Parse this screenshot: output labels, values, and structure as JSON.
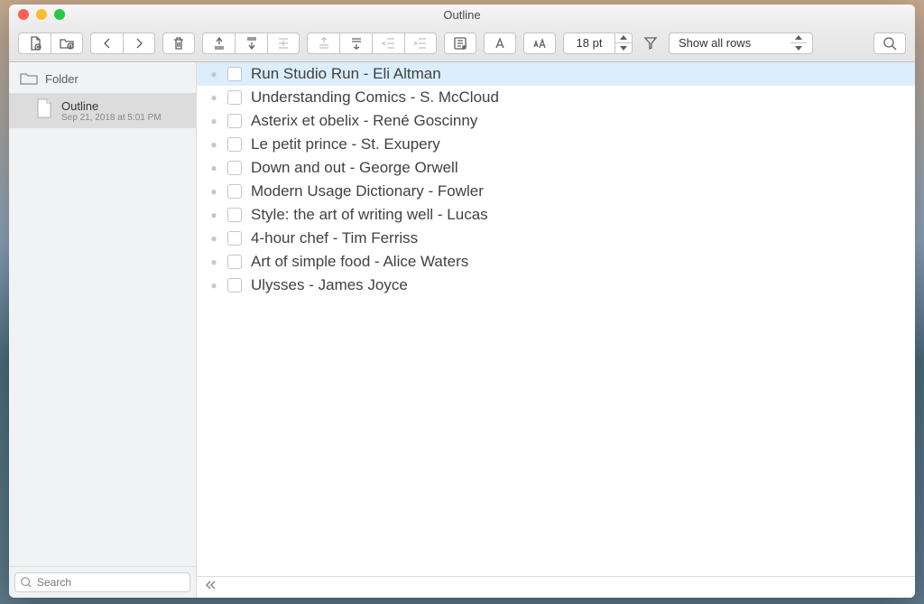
{
  "window": {
    "title": "Outline"
  },
  "toolbar": {
    "font_size": "18 pt",
    "filter_label": "Show all rows"
  },
  "sidebar": {
    "section_label": "Folder",
    "file": {
      "name": "Outline",
      "date": "Sep 21, 2018 at 5:01 PM"
    },
    "search_placeholder": "Search"
  },
  "outline": {
    "rows": [
      {
        "text": "Run Studio Run - Eli Altman",
        "selected": true
      },
      {
        "text": "Understanding Comics - S. McCloud",
        "selected": false
      },
      {
        "text": "Asterix et obelix - René Goscinny",
        "selected": false
      },
      {
        "text": "Le petit prince - St. Exupery",
        "selected": false
      },
      {
        "text": "Down and out - George Orwell",
        "selected": false
      },
      {
        "text": "Modern Usage Dictionary - Fowler",
        "selected": false
      },
      {
        "text": "Style: the art of writing well - Lucas",
        "selected": false
      },
      {
        "text": "4-hour chef - Tim Ferriss",
        "selected": false
      },
      {
        "text": "Art of simple food - Alice Waters",
        "selected": false
      },
      {
        "text": "Ulysses - James Joyce",
        "selected": false
      }
    ]
  }
}
